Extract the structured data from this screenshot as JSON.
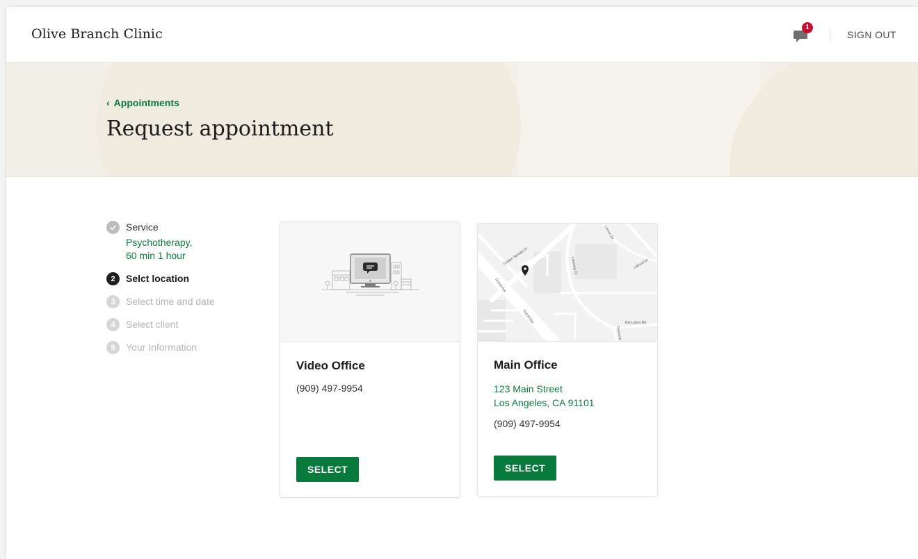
{
  "header": {
    "clinic_name": "Olive Branch Clinic",
    "notification_count": "1",
    "sign_out_label": "SIGN OUT"
  },
  "hero": {
    "back_label": "Appointments",
    "title": "Request appointment"
  },
  "steps": [
    {
      "number": "1",
      "label": "Service",
      "status": "done",
      "detail_line1": "Psychotherapy,",
      "detail_line2": "60 min 1 hour"
    },
    {
      "number": "2",
      "label": "Selct location",
      "status": "active"
    },
    {
      "number": "3",
      "label": "Select time and date",
      "status": "pending"
    },
    {
      "number": "4",
      "label": "Select client",
      "status": "pending"
    },
    {
      "number": "5",
      "label": "Your Information",
      "status": "pending"
    }
  ],
  "locations": [
    {
      "name": "Video Office",
      "phone": "(909) 497-9954",
      "button_label": "SELECT"
    },
    {
      "name": "Main Office",
      "address_line1": "123 Main Street",
      "address_line2": "Los Angeles, CA 91101",
      "phone": "(909) 497-9954",
      "button_label": "SELECT",
      "map_labels": [
        "Golden Springs Dr",
        "Grand Ave",
        "Grand Ave",
        "Lakeway Dr",
        "Laboral Dr",
        "Rio Lobos Rd",
        "Diamond",
        "Lemon Dr"
      ]
    }
  ],
  "colors": {
    "brand_green": "#087a3c",
    "link_green": "#0a7b3e",
    "hero_bg": "#f2efe6",
    "badge_red": "#c8102e"
  }
}
